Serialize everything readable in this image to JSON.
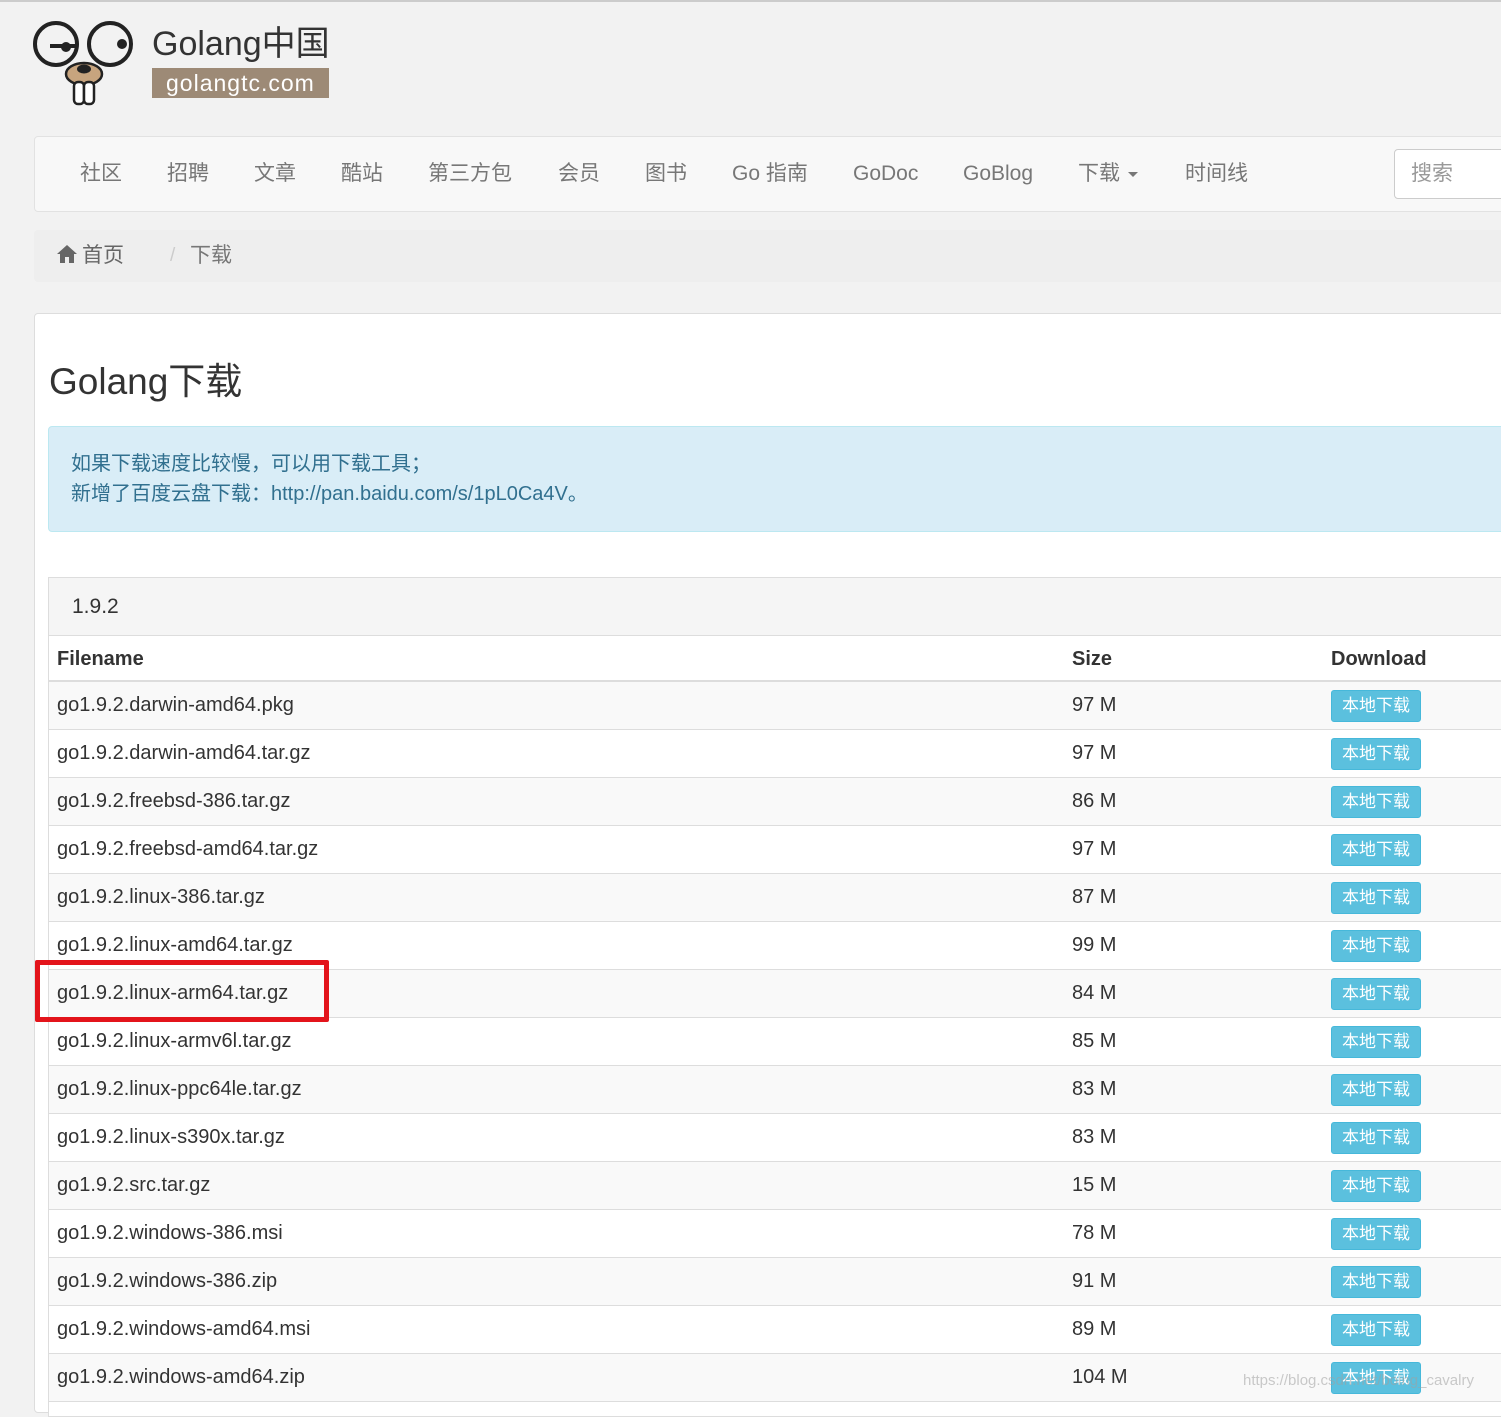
{
  "logo": {
    "title": "Golang中国",
    "domain": "golangtc.com"
  },
  "nav": {
    "items": [
      {
        "label": "社区"
      },
      {
        "label": "招聘"
      },
      {
        "label": "文章"
      },
      {
        "label": "酷站"
      },
      {
        "label": "第三方包"
      },
      {
        "label": "会员"
      },
      {
        "label": "图书"
      },
      {
        "label": "Go 指南"
      },
      {
        "label": "GoDoc"
      },
      {
        "label": "GoBlog"
      },
      {
        "label": "下载"
      },
      {
        "label": "时间线"
      }
    ],
    "search_placeholder": "搜索"
  },
  "breadcrumb": {
    "home": "首页",
    "separator": "/",
    "current": "下载"
  },
  "page": {
    "title": "Golang下载"
  },
  "alert": {
    "line1": "如果下载速度比较慢，可以用下载工具；",
    "line2": "新增了百度云盘下载：http://pan.baidu.com/s/1pL0Ca4V。"
  },
  "release": {
    "version": "1.9.2",
    "columns": {
      "filename": "Filename",
      "size": "Size",
      "download": "Download"
    },
    "download_label": "本地下载",
    "files": [
      {
        "name": "go1.9.2.darwin-amd64.pkg",
        "size": "97 M"
      },
      {
        "name": "go1.9.2.darwin-amd64.tar.gz",
        "size": "97 M"
      },
      {
        "name": "go1.9.2.freebsd-386.tar.gz",
        "size": "86 M"
      },
      {
        "name": "go1.9.2.freebsd-amd64.tar.gz",
        "size": "97 M"
      },
      {
        "name": "go1.9.2.linux-386.tar.gz",
        "size": "87 M"
      },
      {
        "name": "go1.9.2.linux-amd64.tar.gz",
        "size": "99 M"
      },
      {
        "name": "go1.9.2.linux-arm64.tar.gz",
        "size": "84 M"
      },
      {
        "name": "go1.9.2.linux-armv6l.tar.gz",
        "size": "85 M"
      },
      {
        "name": "go1.9.2.linux-ppc64le.tar.gz",
        "size": "83 M"
      },
      {
        "name": "go1.9.2.linux-s390x.tar.gz",
        "size": "83 M"
      },
      {
        "name": "go1.9.2.src.tar.gz",
        "size": "15 M"
      },
      {
        "name": "go1.9.2.windows-386.msi",
        "size": "78 M"
      },
      {
        "name": "go1.9.2.windows-386.zip",
        "size": "91 M"
      },
      {
        "name": "go1.9.2.windows-amd64.msi",
        "size": "89 M"
      },
      {
        "name": "go1.9.2.windows-amd64.zip",
        "size": "104 M"
      }
    ]
  },
  "watermark": "https://blog.csdn.net/boing_cavalry",
  "colors": {
    "highlight": "#e3141b",
    "info_button": "#5bc0de",
    "alert_bg": "#d9edf7",
    "logo_badge": "#9d8a76"
  }
}
